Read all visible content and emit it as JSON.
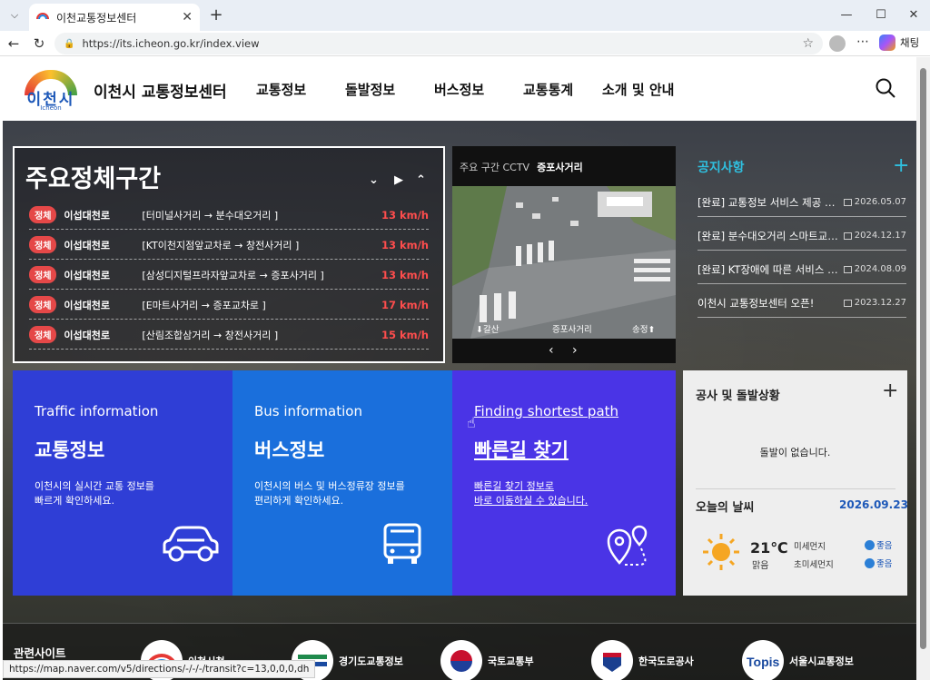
{
  "browser": {
    "tab_title": "이천교통정보센터",
    "url": "https://its.icheon.go.kr/index.view",
    "copilot_label": "채팅",
    "status_url": "https://map.naver.com/v5/directions/-/-/-/transit?c=13,0,0,0,dh"
  },
  "site": {
    "logo_text": "이천시",
    "logo_sub": "Icheon",
    "title": "이천시 교통정보센터",
    "nav": [
      "교통정보",
      "돌발정보",
      "버스정보",
      "교통통계",
      "소개 및 안내"
    ]
  },
  "congestion": {
    "title": "주요정체구간",
    "rows": [
      {
        "badge": "정체",
        "road": "이섭대천로",
        "section": "[터미널사거리 → 분수대오거리 ]",
        "speed": "13 km/h"
      },
      {
        "badge": "정체",
        "road": "이섭대천로",
        "section": "[KT이천지점앞교차로 → 창전사거리 ]",
        "speed": "13 km/h"
      },
      {
        "badge": "정체",
        "road": "이섭대천로",
        "section": "[삼성디지털프라자앞교차로 → 증포사거리 ]",
        "speed": "13 km/h"
      },
      {
        "badge": "정체",
        "road": "이섭대천로",
        "section": "[E마트사거리 → 증포교차로 ]",
        "speed": "17 km/h"
      },
      {
        "badge": "정체",
        "road": "이섭대천로",
        "section": "[산림조합삼거리 → 창전사거리 ]",
        "speed": "15 km/h"
      }
    ]
  },
  "cctv": {
    "label": "주요 구간 CCTV",
    "location": "증포사거리",
    "cap_left": "⬇갈산",
    "cap_mid": "증포사거리",
    "cap_right": "송정⬆"
  },
  "notices": {
    "title": "공지사항",
    "items": [
      {
        "text": "[완료] 교통정보 서비스 제공 중단 안내",
        "date": "2026.05.07"
      },
      {
        "text": "[완료] 분수대오거리 스마트교차로 공사",
        "date": "2024.12.17"
      },
      {
        "text": "[완료] KT장애에 따른 서비스 중단",
        "date": "2024.08.09"
      },
      {
        "text": "이천시 교통정보센터 오픈!",
        "date": "2023.12.27"
      }
    ]
  },
  "tiles": [
    {
      "en": "Traffic information",
      "ko": "교통정보",
      "desc1": "이천시의 실시간 교통 정보를",
      "desc2": "빠르게 확인하세요.",
      "color": "#2f3ed6"
    },
    {
      "en": "Bus information",
      "ko": "버스정보",
      "desc1": "이천시의 버스 및 버스정류장 정보를",
      "desc2": "편리하게 확인하세요.",
      "color": "#1a6fdc"
    },
    {
      "en": "Finding shortest path",
      "ko": "빠른길 찾기",
      "desc1": "빠른길 찾기 정보로",
      "desc2": "바로 이동하실 수 있습니다.",
      "color": "#4a34e6"
    }
  ],
  "construction": {
    "title": "공사 및 돌발상황",
    "message": "돌발이 없습니다."
  },
  "weather": {
    "title": "오늘의 날씨",
    "date": "2026.09.23",
    "temp": "21℃",
    "sky": "맑음",
    "dust_label": "미세먼지",
    "dust_value": "좋음",
    "fine_dust_label": "초미세먼지",
    "fine_dust_value": "좋음"
  },
  "related": {
    "title": "관련사이트",
    "sites": [
      "이천시청",
      "경기도교통정보",
      "국토교통부",
      "한국도로공사",
      "서울시교통정보"
    ]
  }
}
